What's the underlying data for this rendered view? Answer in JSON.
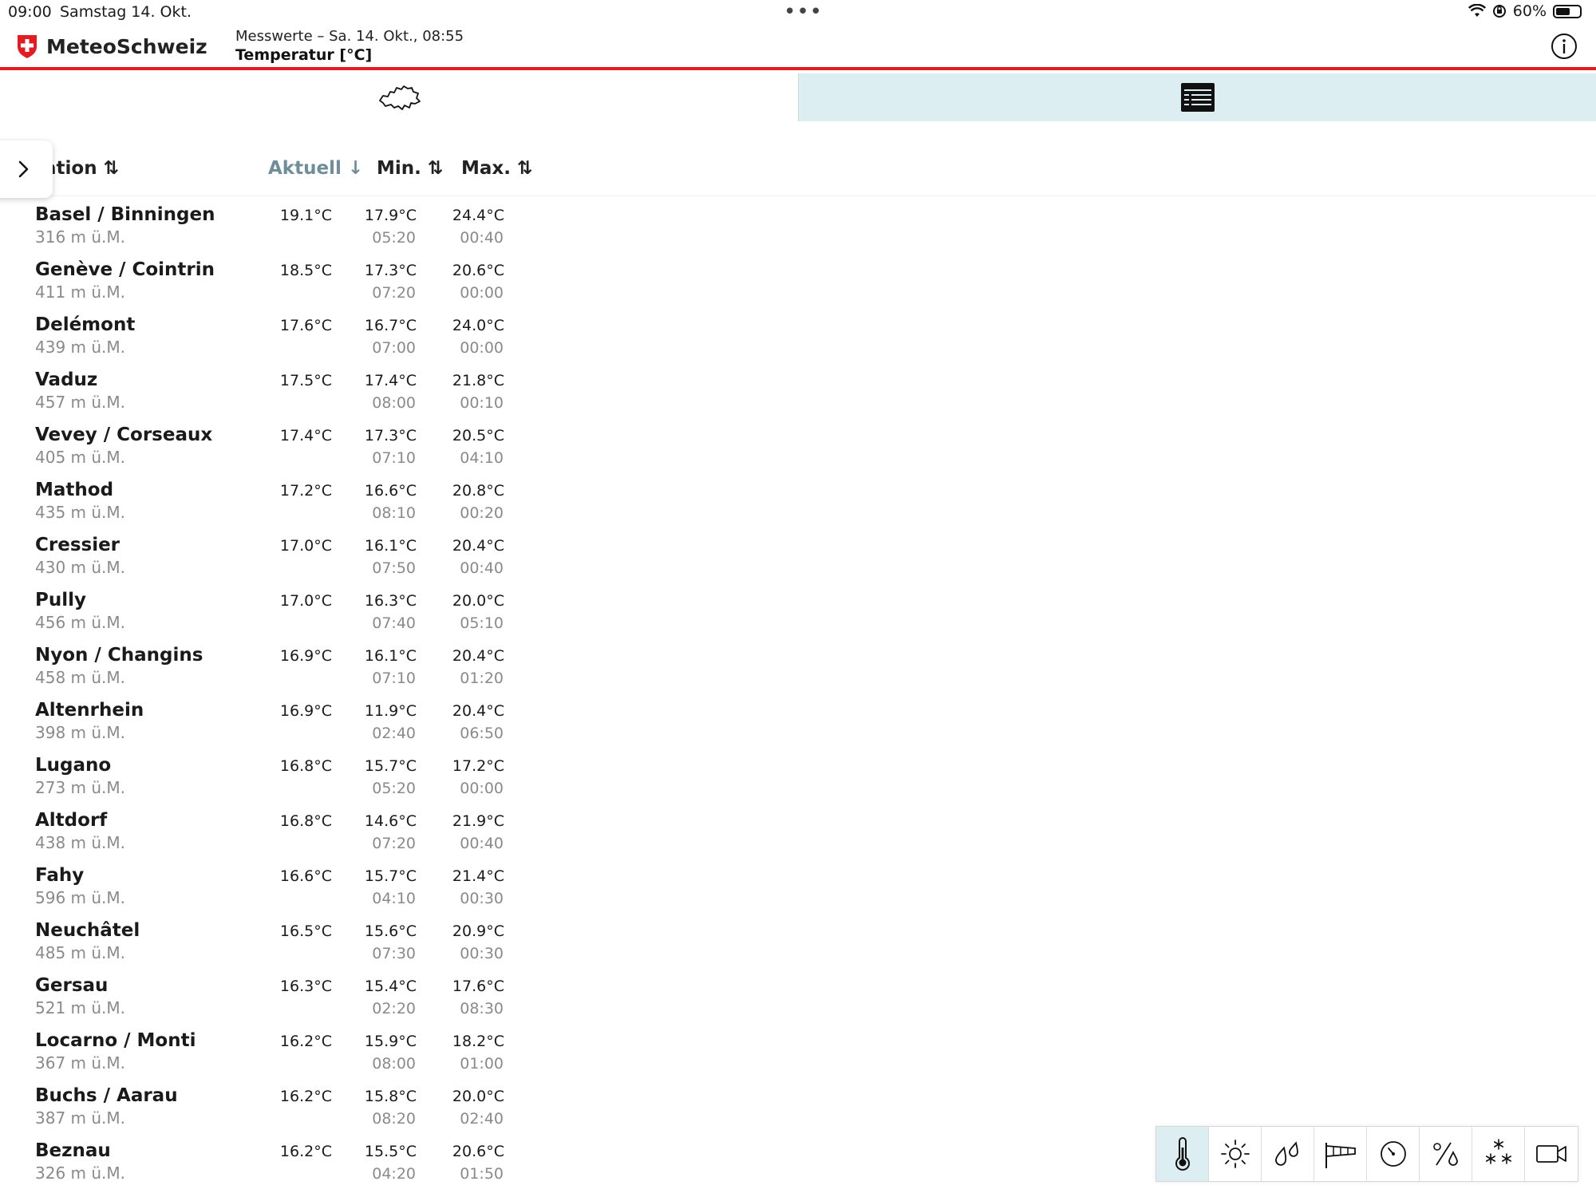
{
  "status_bar": {
    "time": "09:00",
    "date": "Samstag 14. Okt.",
    "battery": "60%",
    "battery_level": 0.6
  },
  "header": {
    "app_name": "MeteoSchweiz",
    "subtitle": "Messwerte – Sa. 14. Okt., 08:55",
    "title": "Temperatur [°C]"
  },
  "view_tabs": [
    {
      "icon": "switzerland-map-icon",
      "active": false
    },
    {
      "icon": "list-icon",
      "active": true
    }
  ],
  "table": {
    "columns": {
      "station": "ation ⇅",
      "aktuell": "Aktuell ↓",
      "min": "Min. ⇅",
      "max": "Max. ⇅"
    },
    "rows": [
      {
        "name": "Basel / Binningen",
        "elev": "316 m ü.M.",
        "now": "19.1°C",
        "min": "17.9°C",
        "min_time": "05:20",
        "max": "24.4°C",
        "max_time": "00:40"
      },
      {
        "name": "Genève / Cointrin",
        "elev": "411 m ü.M.",
        "now": "18.5°C",
        "min": "17.3°C",
        "min_time": "07:20",
        "max": "20.6°C",
        "max_time": "00:00"
      },
      {
        "name": "Delémont",
        "elev": "439 m ü.M.",
        "now": "17.6°C",
        "min": "16.7°C",
        "min_time": "07:00",
        "max": "24.0°C",
        "max_time": "00:00"
      },
      {
        "name": "Vaduz",
        "elev": "457 m ü.M.",
        "now": "17.5°C",
        "min": "17.4°C",
        "min_time": "08:00",
        "max": "21.8°C",
        "max_time": "00:10"
      },
      {
        "name": "Vevey / Corseaux",
        "elev": "405 m ü.M.",
        "now": "17.4°C",
        "min": "17.3°C",
        "min_time": "07:10",
        "max": "20.5°C",
        "max_time": "04:10"
      },
      {
        "name": "Mathod",
        "elev": "435 m ü.M.",
        "now": "17.2°C",
        "min": "16.6°C",
        "min_time": "08:10",
        "max": "20.8°C",
        "max_time": "00:20"
      },
      {
        "name": "Cressier",
        "elev": "430 m ü.M.",
        "now": "17.0°C",
        "min": "16.1°C",
        "min_time": "07:50",
        "max": "20.4°C",
        "max_time": "00:40"
      },
      {
        "name": "Pully",
        "elev": "456 m ü.M.",
        "now": "17.0°C",
        "min": "16.3°C",
        "min_time": "07:40",
        "max": "20.0°C",
        "max_time": "05:10"
      },
      {
        "name": "Nyon / Changins",
        "elev": "458 m ü.M.",
        "now": "16.9°C",
        "min": "16.1°C",
        "min_time": "07:10",
        "max": "20.4°C",
        "max_time": "01:20"
      },
      {
        "name": "Altenrhein",
        "elev": "398 m ü.M.",
        "now": "16.9°C",
        "min": "11.9°C",
        "min_time": "02:40",
        "max": "20.4°C",
        "max_time": "06:50"
      },
      {
        "name": "Lugano",
        "elev": "273 m ü.M.",
        "now": "16.8°C",
        "min": "15.7°C",
        "min_time": "05:20",
        "max": "17.2°C",
        "max_time": "00:00"
      },
      {
        "name": "Altdorf",
        "elev": "438 m ü.M.",
        "now": "16.8°C",
        "min": "14.6°C",
        "min_time": "07:20",
        "max": "21.9°C",
        "max_time": "00:40"
      },
      {
        "name": "Fahy",
        "elev": "596 m ü.M.",
        "now": "16.6°C",
        "min": "15.7°C",
        "min_time": "04:10",
        "max": "21.4°C",
        "max_time": "00:30"
      },
      {
        "name": "Neuchâtel",
        "elev": "485 m ü.M.",
        "now": "16.5°C",
        "min": "15.6°C",
        "min_time": "07:30",
        "max": "20.9°C",
        "max_time": "00:30"
      },
      {
        "name": "Gersau",
        "elev": "521 m ü.M.",
        "now": "16.3°C",
        "min": "15.4°C",
        "min_time": "02:20",
        "max": "17.6°C",
        "max_time": "08:30"
      },
      {
        "name": "Locarno / Monti",
        "elev": "367 m ü.M.",
        "now": "16.2°C",
        "min": "15.9°C",
        "min_time": "08:00",
        "max": "18.2°C",
        "max_time": "01:00"
      },
      {
        "name": "Buchs / Aarau",
        "elev": "387 m ü.M.",
        "now": "16.2°C",
        "min": "15.8°C",
        "min_time": "08:20",
        "max": "20.0°C",
        "max_time": "02:40"
      },
      {
        "name": "Beznau",
        "elev": "326 m ü.M.",
        "now": "16.2°C",
        "min": "15.5°C",
        "min_time": "04:20",
        "max": "20.6°C",
        "max_time": "01:50"
      }
    ]
  },
  "parameter_toolbar": [
    {
      "icon": "thermometer-icon",
      "active": true
    },
    {
      "icon": "sun-icon",
      "active": false
    },
    {
      "icon": "precipitation-drops-icon",
      "active": false
    },
    {
      "icon": "windsock-icon",
      "active": false
    },
    {
      "icon": "pressure-gauge-icon",
      "active": false
    },
    {
      "icon": "humidity-percent-icon",
      "active": false
    },
    {
      "icon": "snow-icon",
      "active": false
    },
    {
      "icon": "webcam-icon",
      "active": false
    }
  ],
  "colors": {
    "accent_red": "#e31b23",
    "active_tab_bg": "#ddeef2",
    "sorted_column": "#6f8e9a",
    "secondary_text": "#8a8a8a"
  }
}
